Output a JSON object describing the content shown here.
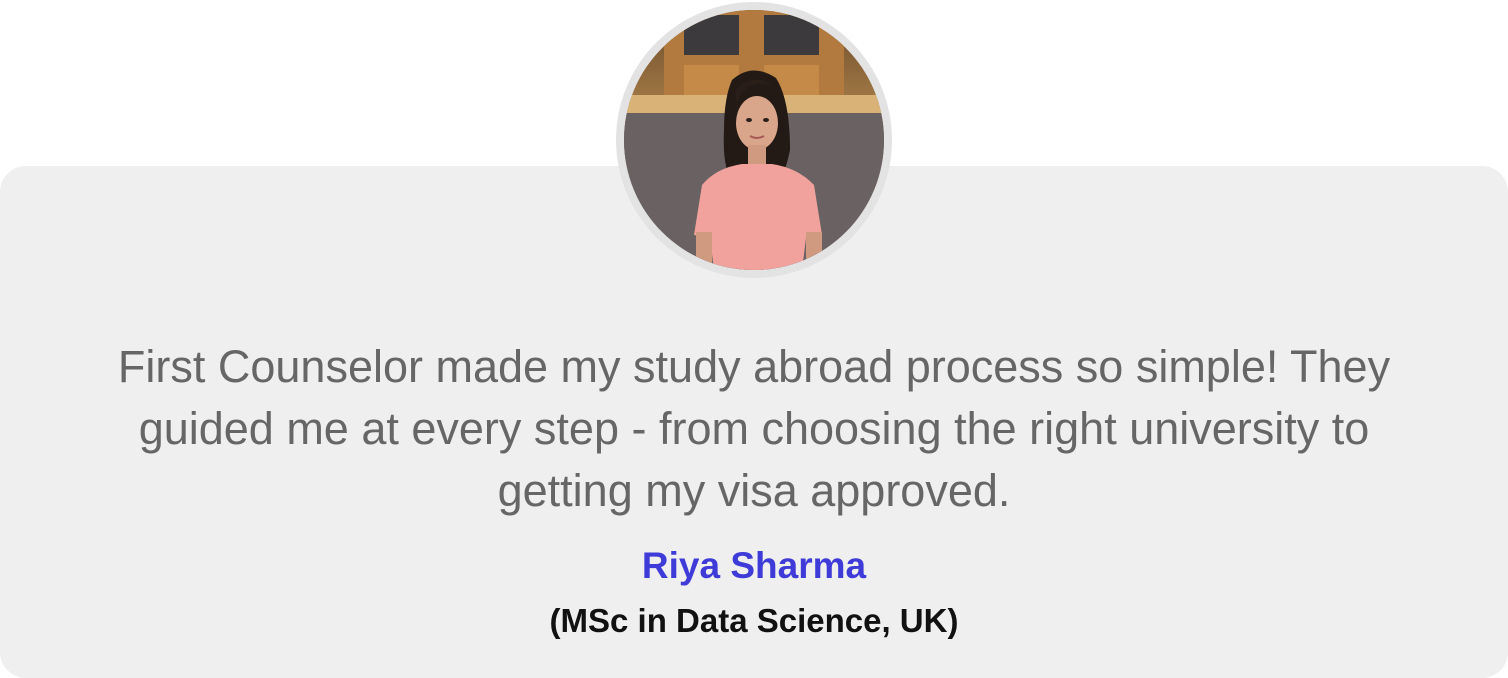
{
  "testimonial": {
    "quote": "First Counselor made my study abroad process so simple! They guided me at every step - from choosing the right university to getting my visa approved.",
    "name": "Riya Sharma",
    "program": "(MSc in Data Science, UK)"
  },
  "colors": {
    "card_background": "#efefef",
    "quote_text": "#666666",
    "name_text": "#3f3bd8",
    "program_text": "#111111",
    "avatar_ring": "#e3e3e3"
  },
  "icons": {
    "avatar": "student-photo"
  }
}
